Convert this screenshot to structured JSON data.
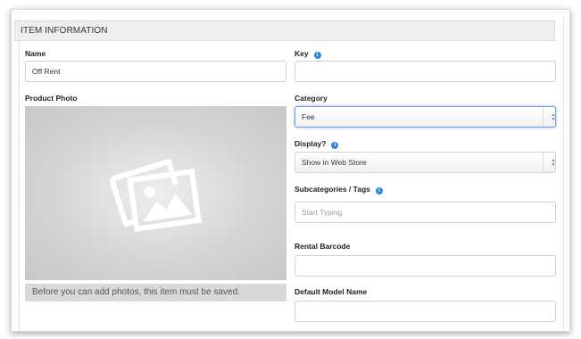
{
  "section": {
    "title": "ITEM INFORMATION"
  },
  "fields": {
    "name": {
      "label": "Name",
      "value": "Off Rent"
    },
    "key": {
      "label": "Key",
      "value": "",
      "icon": "info-icon"
    },
    "product_photo": {
      "label": "Product Photo",
      "icon": "image-placeholder-icon"
    },
    "photo_notice": "Before you can add photos, this item must be saved.",
    "category": {
      "label": "Category",
      "selected": "Fee"
    },
    "display": {
      "label": "Display?",
      "selected": "Show in Web Store",
      "icon": "info-icon"
    },
    "subcategories": {
      "label": "Subcategories / Tags",
      "placeholder": "Start Typing",
      "icon": "info-icon"
    },
    "rental_barcode": {
      "label": "Rental Barcode",
      "value": ""
    },
    "default_model_name": {
      "label": "Default Model Name",
      "value": ""
    }
  },
  "colors": {
    "info_icon": "#2f86d6",
    "focus_border": "#6aa0e0",
    "header_bg": "#eeeeee"
  }
}
